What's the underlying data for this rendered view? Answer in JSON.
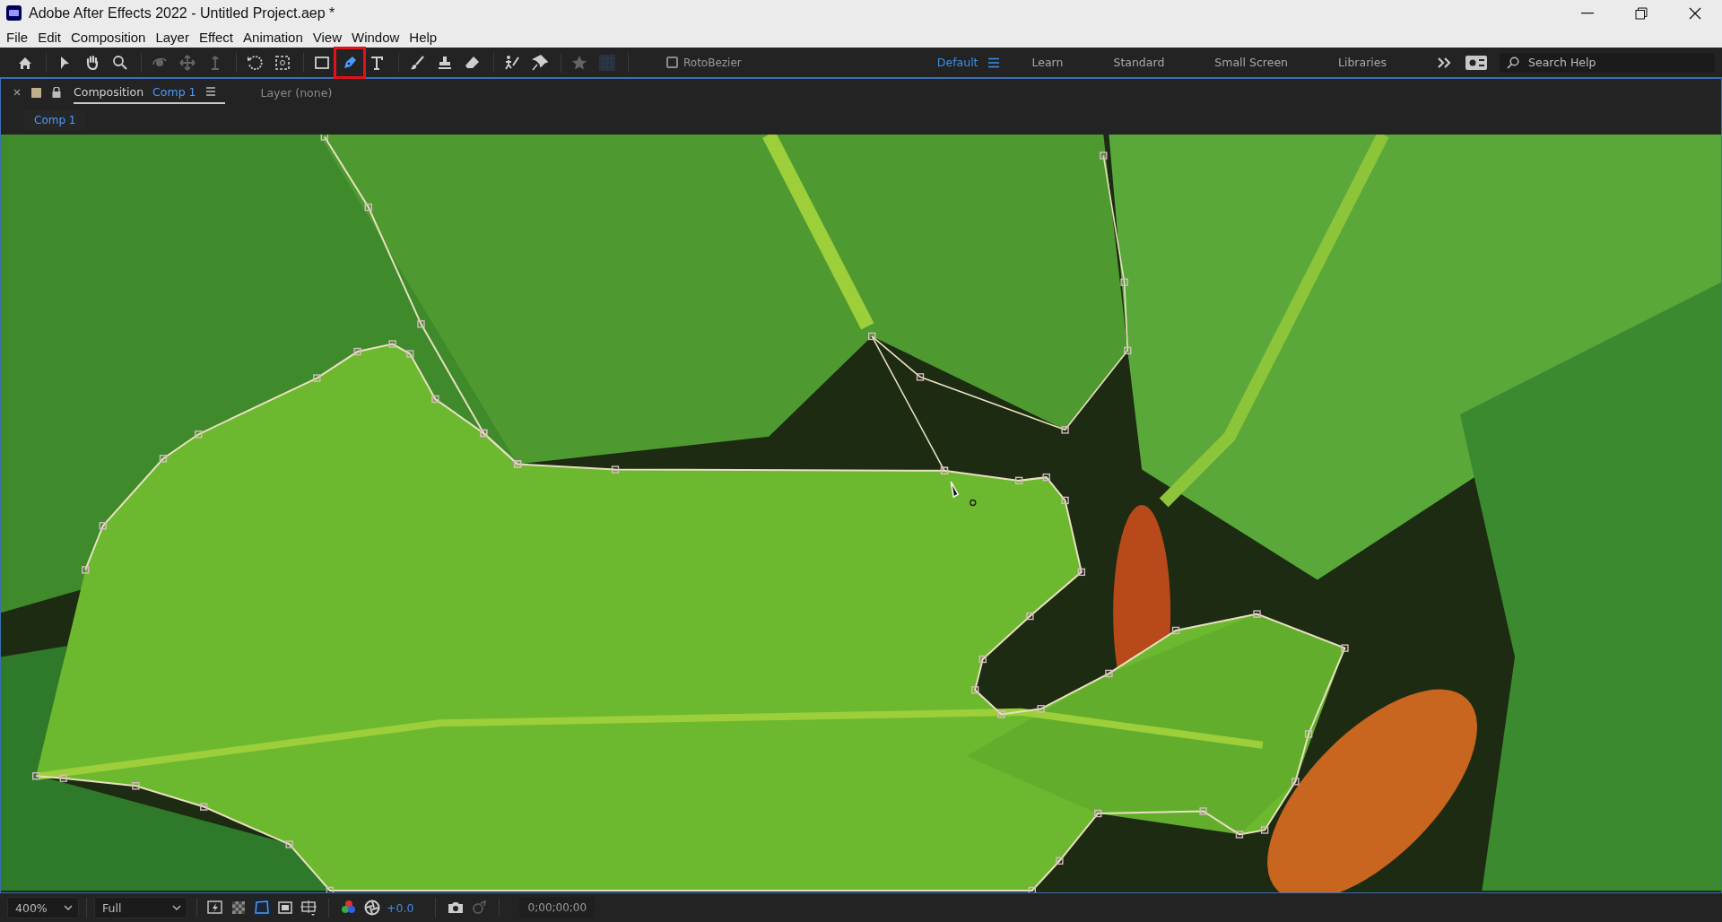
{
  "window": {
    "title": "Adobe After Effects 2022 - Untitled Project.aep *"
  },
  "menu": [
    "File",
    "Edit",
    "Composition",
    "Layer",
    "Effect",
    "Animation",
    "View",
    "Window",
    "Help"
  ],
  "tools": [
    {
      "kind": "home",
      "disabled": false,
      "selected": false
    },
    {
      "kind": "selection",
      "disabled": false,
      "selected": false
    },
    {
      "kind": "hand",
      "disabled": false,
      "selected": false
    },
    {
      "kind": "zoom",
      "disabled": false,
      "selected": false
    },
    {
      "kind": "orbit",
      "disabled": true,
      "selected": false
    },
    {
      "kind": "pan",
      "disabled": true,
      "selected": false
    },
    {
      "kind": "dolly",
      "disabled": true,
      "selected": false
    },
    {
      "kind": "rotate",
      "disabled": false,
      "selected": false
    },
    {
      "kind": "anchor",
      "disabled": false,
      "selected": false
    },
    {
      "kind": "rectangle",
      "disabled": false,
      "selected": false
    },
    {
      "kind": "pen",
      "disabled": false,
      "selected": true
    },
    {
      "kind": "type",
      "disabled": false,
      "selected": false
    },
    {
      "kind": "brush",
      "disabled": false,
      "selected": false
    },
    {
      "kind": "stamp",
      "disabled": false,
      "selected": false
    },
    {
      "kind": "eraser",
      "disabled": false,
      "selected": false
    },
    {
      "kind": "roto",
      "disabled": false,
      "selected": false
    },
    {
      "kind": "pin",
      "disabled": false,
      "selected": false
    },
    {
      "kind": "star",
      "disabled": true,
      "selected": false
    },
    {
      "kind": "snap",
      "disabled": true,
      "selected": false
    }
  ],
  "rotobezier": {
    "label": "RotoBezier",
    "checked": false
  },
  "workspaces": [
    {
      "label": "Default",
      "selected": true
    },
    {
      "label": "Learn",
      "selected": false
    },
    {
      "label": "Standard",
      "selected": false
    },
    {
      "label": "Small Screen",
      "selected": false
    },
    {
      "label": "Libraries",
      "selected": false
    }
  ],
  "search": {
    "placeholder": "Search Help"
  },
  "panel_tabs": [
    {
      "label": "Composition",
      "name": "Comp 1",
      "selected": true
    },
    {
      "label": "Layer (none)",
      "selected": false
    }
  ],
  "breadcrumb": "Comp 1",
  "bottom_bar": {
    "zoom": "400%",
    "resolution": "Full",
    "exposure": "+0.0",
    "timecode": "0;00;00;00"
  }
}
